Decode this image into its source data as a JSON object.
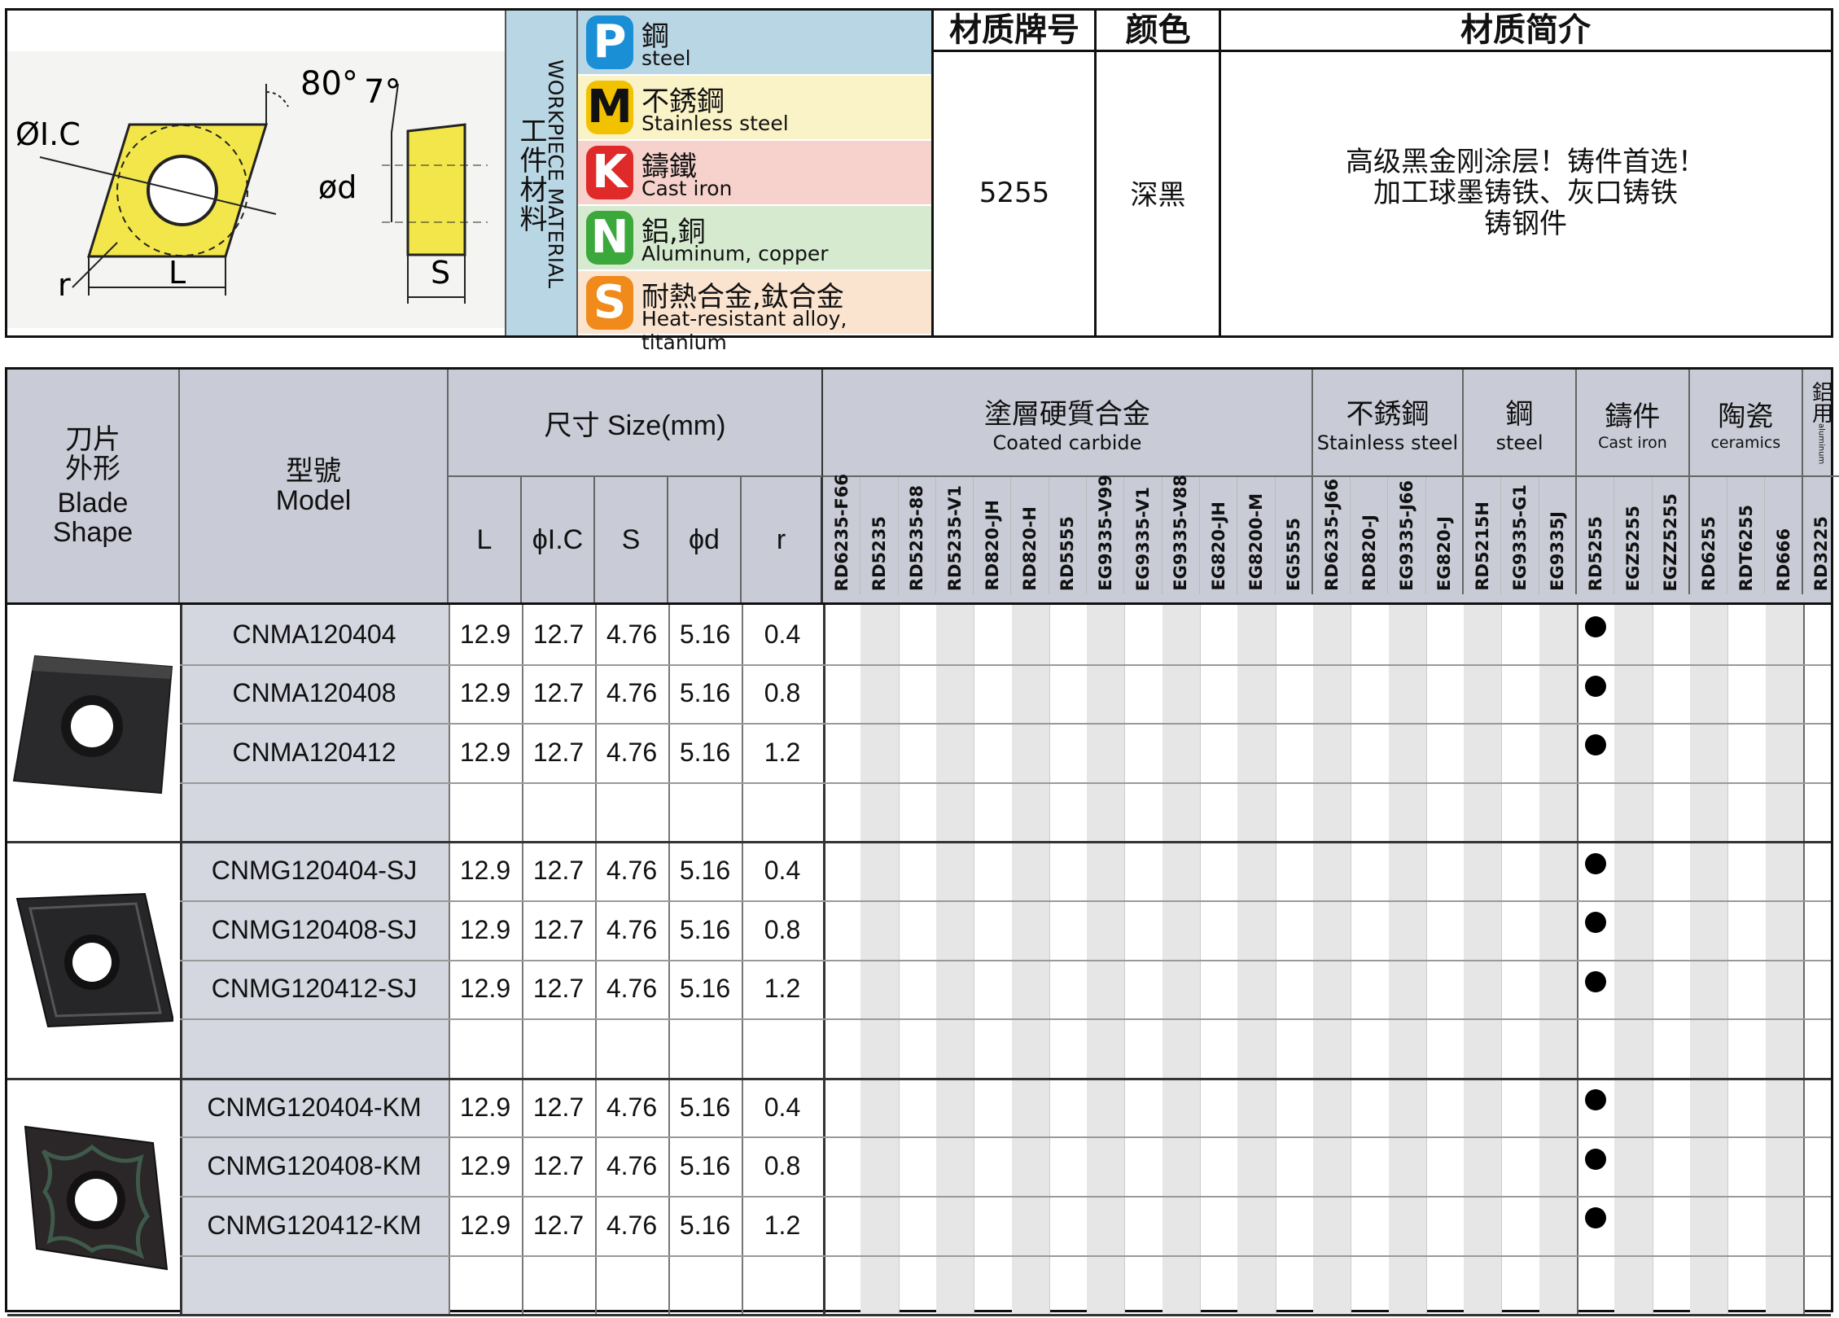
{
  "top": {
    "diagram_labels": {
      "angle1": "80°",
      "angle2": "7°",
      "ic": "ØI.C",
      "d": "ød",
      "r": "r",
      "L": "L",
      "S": "S"
    },
    "workpiece_cn": "工件材料",
    "workpiece_en": "WORKPIECE MATERIAL",
    "materials": [
      {
        "letter": "P",
        "cn": "鋼",
        "en": "steel",
        "color": "#1a8fd6",
        "bg": "#b9d6e4"
      },
      {
        "letter": "M",
        "cn": "不銹鋼",
        "en": "Stainless steel",
        "color": "#f2c200",
        "bg": "#fbf3c8"
      },
      {
        "letter": "K",
        "cn": "鑄鐵",
        "en": "Cast iron",
        "color": "#e02a2a",
        "bg": "#f7d2cc"
      },
      {
        "letter": "N",
        "cn": "鋁,銅",
        "en": "Aluminum, copper",
        "color": "#3aa83a",
        "bg": "#d6ead0"
      },
      {
        "letter": "S",
        "cn": "耐熱合金,鈦合金",
        "en": "Heat-resistant alloy, titanium",
        "color": "#f08a1a",
        "bg": "#fbe4cf"
      }
    ],
    "headers": {
      "grade": "材质牌号",
      "color": "颜色",
      "intro": "材质简介"
    },
    "grade_value": "5255",
    "color_value": "深黑",
    "intro_lines": [
      "高级黑金刚涂层！铸件首选！",
      "加工球墨铸铁、灰口铸铁",
      "铸钢件"
    ]
  },
  "table": {
    "h_shape_cn": "刀片\n外形",
    "h_shape_en": "Blade\nShape",
    "h_model_cn": "型號",
    "h_model_en": "Model",
    "h_size": "尺寸 Size(mm)",
    "size_cols": [
      "L",
      "ϕI.C",
      "S",
      "ϕd",
      "r"
    ],
    "groups": [
      {
        "cn": "塗層硬質合金",
        "en": "Coated carbide"
      },
      {
        "cn": "不銹鋼",
        "en": "Stainless steel"
      },
      {
        "cn": "鋼",
        "en": "steel"
      },
      {
        "cn": "鑄件",
        "en": "Cast iron"
      },
      {
        "cn": "陶瓷",
        "en": "ceramics"
      },
      {
        "cn": "鋁用",
        "en": "aluminum"
      }
    ],
    "grades": [
      "RD6235-F66",
      "RD5235",
      "RD5235-88",
      "RD5235-V1",
      "RD820-JH",
      "RD820-H",
      "RD5555",
      "EG9335-V99",
      "EG9335-V1",
      "EG9335-V88",
      "EG820-JH",
      "EG8200-M",
      "EG5555",
      "RD6235-J66",
      "RD820-J",
      "EG9335-J66",
      "EG820-J",
      "RD5215H",
      "EG9335-G1",
      "EG9335J",
      "RD5255",
      "EGZ5255",
      "EGZZ5255",
      "RD6255",
      "RDT6255",
      "RD666",
      "RD3225"
    ],
    "rows": [
      {
        "model": "CNMA120404",
        "L": "12.9",
        "IC": "12.7",
        "S": "4.76",
        "d": "5.16",
        "r": "0.4",
        "mark": "RD5255"
      },
      {
        "model": "CNMA120408",
        "L": "12.9",
        "IC": "12.7",
        "S": "4.76",
        "d": "5.16",
        "r": "0.8",
        "mark": "RD5255"
      },
      {
        "model": "CNMA120412",
        "L": "12.9",
        "IC": "12.7",
        "S": "4.76",
        "d": "5.16",
        "r": "1.2",
        "mark": "RD5255"
      },
      {
        "model": "",
        "L": "",
        "IC": "",
        "S": "",
        "d": "",
        "r": "",
        "mark": ""
      },
      {
        "model": "CNMG120404-SJ",
        "L": "12.9",
        "IC": "12.7",
        "S": "4.76",
        "d": "5.16",
        "r": "0.4",
        "mark": "RD5255"
      },
      {
        "model": "CNMG120408-SJ",
        "L": "12.9",
        "IC": "12.7",
        "S": "4.76",
        "d": "5.16",
        "r": "0.8",
        "mark": "RD5255"
      },
      {
        "model": "CNMG120412-SJ",
        "L": "12.9",
        "IC": "12.7",
        "S": "4.76",
        "d": "5.16",
        "r": "1.2",
        "mark": "RD5255"
      },
      {
        "model": "",
        "L": "",
        "IC": "",
        "S": "",
        "d": "",
        "r": "",
        "mark": ""
      },
      {
        "model": "CNMG120404-KM",
        "L": "12.9",
        "IC": "12.7",
        "S": "4.76",
        "d": "5.16",
        "r": "0.4",
        "mark": "RD5255"
      },
      {
        "model": "CNMG120408-KM",
        "L": "12.9",
        "IC": "12.7",
        "S": "4.76",
        "d": "5.16",
        "r": "0.8",
        "mark": "RD5255"
      },
      {
        "model": "CNMG120412-KM",
        "L": "12.9",
        "IC": "12.7",
        "S": "4.76",
        "d": "5.16",
        "r": "1.2",
        "mark": "RD5255"
      },
      {
        "model": "",
        "L": "",
        "IC": "",
        "S": "",
        "d": "",
        "r": "",
        "mark": ""
      }
    ]
  },
  "colors": {
    "header_bg": "#c9cbd6",
    "model_bg": "#d4d6e0",
    "stripe": "#e6e6e6",
    "yellow": "#f2e64a"
  }
}
